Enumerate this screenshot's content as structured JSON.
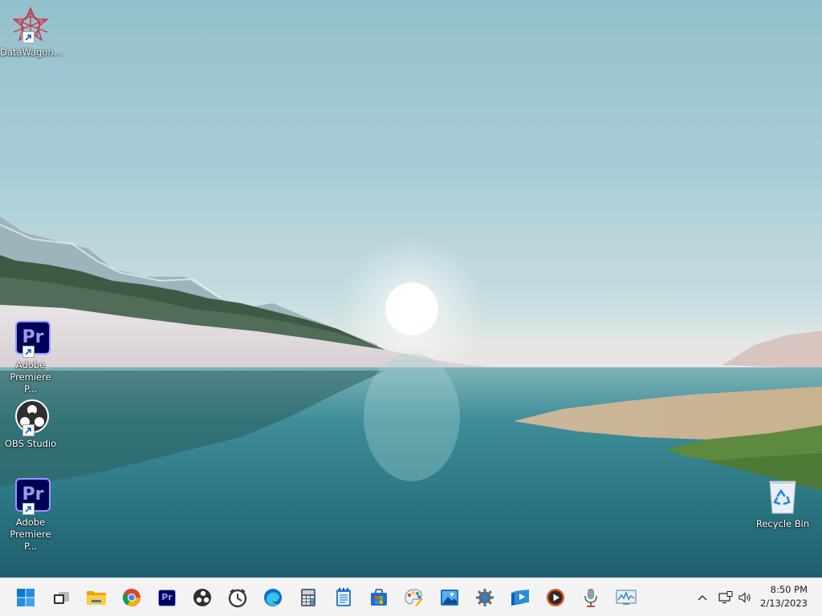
{
  "desktop": {
    "icons": [
      {
        "name": "datawagon",
        "label": "DataWagon..."
      },
      {
        "name": "premiere-1",
        "label": "Adobe Premiere P..."
      },
      {
        "name": "obs",
        "label": "OBS Studio"
      },
      {
        "name": "premiere-2",
        "label": "Adobe Premiere P..."
      },
      {
        "name": "recycle-bin",
        "label": "Recycle Bin"
      }
    ],
    "premiere_glyph": "Pr"
  },
  "taskbar": {
    "apps": [
      {
        "name": "start-button",
        "icon": "windows-logo-icon"
      },
      {
        "name": "task-view-button",
        "icon": "task-view-icon"
      },
      {
        "name": "file-explorer-button",
        "icon": "folder-icon"
      },
      {
        "name": "chrome-button",
        "icon": "chrome-icon"
      },
      {
        "name": "premiere-taskbar-button",
        "icon": "premiere-icon",
        "text": "Pr"
      },
      {
        "name": "obs-taskbar-button",
        "icon": "obs-icon"
      },
      {
        "name": "clock-app-button",
        "icon": "alarm-clock-icon"
      },
      {
        "name": "edge-button",
        "icon": "edge-icon"
      },
      {
        "name": "calculator-button",
        "icon": "calculator-icon"
      },
      {
        "name": "notepad-button",
        "icon": "notepad-icon"
      },
      {
        "name": "store-button",
        "icon": "store-icon"
      },
      {
        "name": "paint-button",
        "icon": "paint-icon"
      },
      {
        "name": "photos-button",
        "icon": "photos-icon"
      },
      {
        "name": "settings-button",
        "icon": "gear-icon"
      },
      {
        "name": "media-player-button",
        "icon": "media-player-icon"
      },
      {
        "name": "player-button",
        "icon": "play-circle-icon"
      },
      {
        "name": "voice-recorder-button",
        "icon": "microphone-icon"
      },
      {
        "name": "performance-monitor-button",
        "icon": "monitor-graph-icon"
      }
    ],
    "tray": {
      "chevron": "^",
      "network_icon": "network-icon",
      "volume_icon": "volume-icon"
    },
    "clock": {
      "time": "8:50 PM",
      "date": "2/13/2023"
    }
  },
  "colors": {
    "taskbar_bg": "#f3f3f3",
    "premiere_bg": "#00005b",
    "premiere_fg": "#9999ff",
    "windows_blue": "#0078d4"
  }
}
